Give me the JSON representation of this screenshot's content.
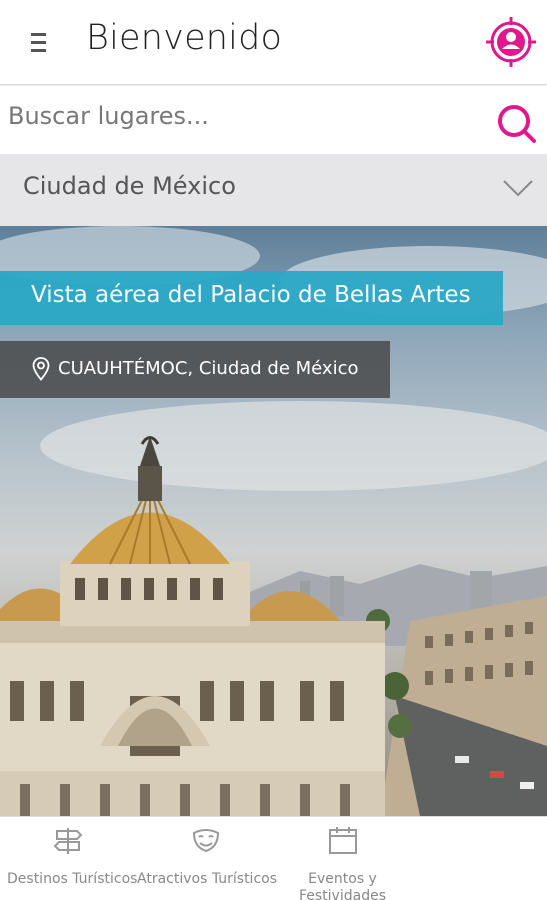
{
  "header": {
    "title": "Bienvenido",
    "menu_icon": "hamburger-icon",
    "profile_icon": "profile-target-icon",
    "accent_color": "#e0188c"
  },
  "search": {
    "placeholder": "Buscar lugares...",
    "icon": "search-icon"
  },
  "city_selector": {
    "selected": "Ciudad de México",
    "icon": "chevron-down-icon"
  },
  "featured": {
    "title": "Vista aérea del Palacio de Bellas Artes",
    "location": "CUAUHTÉMOC, Ciudad de México",
    "location_icon": "map-pin-icon",
    "title_badge_color": "#2ba9c7"
  },
  "bottom_nav": {
    "items": [
      {
        "label": "Destinos Turísticos",
        "icon": "signpost-icon"
      },
      {
        "label": "Atractivos Turísticos",
        "icon": "theater-masks-icon"
      },
      {
        "label": "Eventos y Festividades",
        "line1": "Eventos y",
        "line2": "Festividades",
        "icon": "calendar-icon"
      }
    ]
  }
}
